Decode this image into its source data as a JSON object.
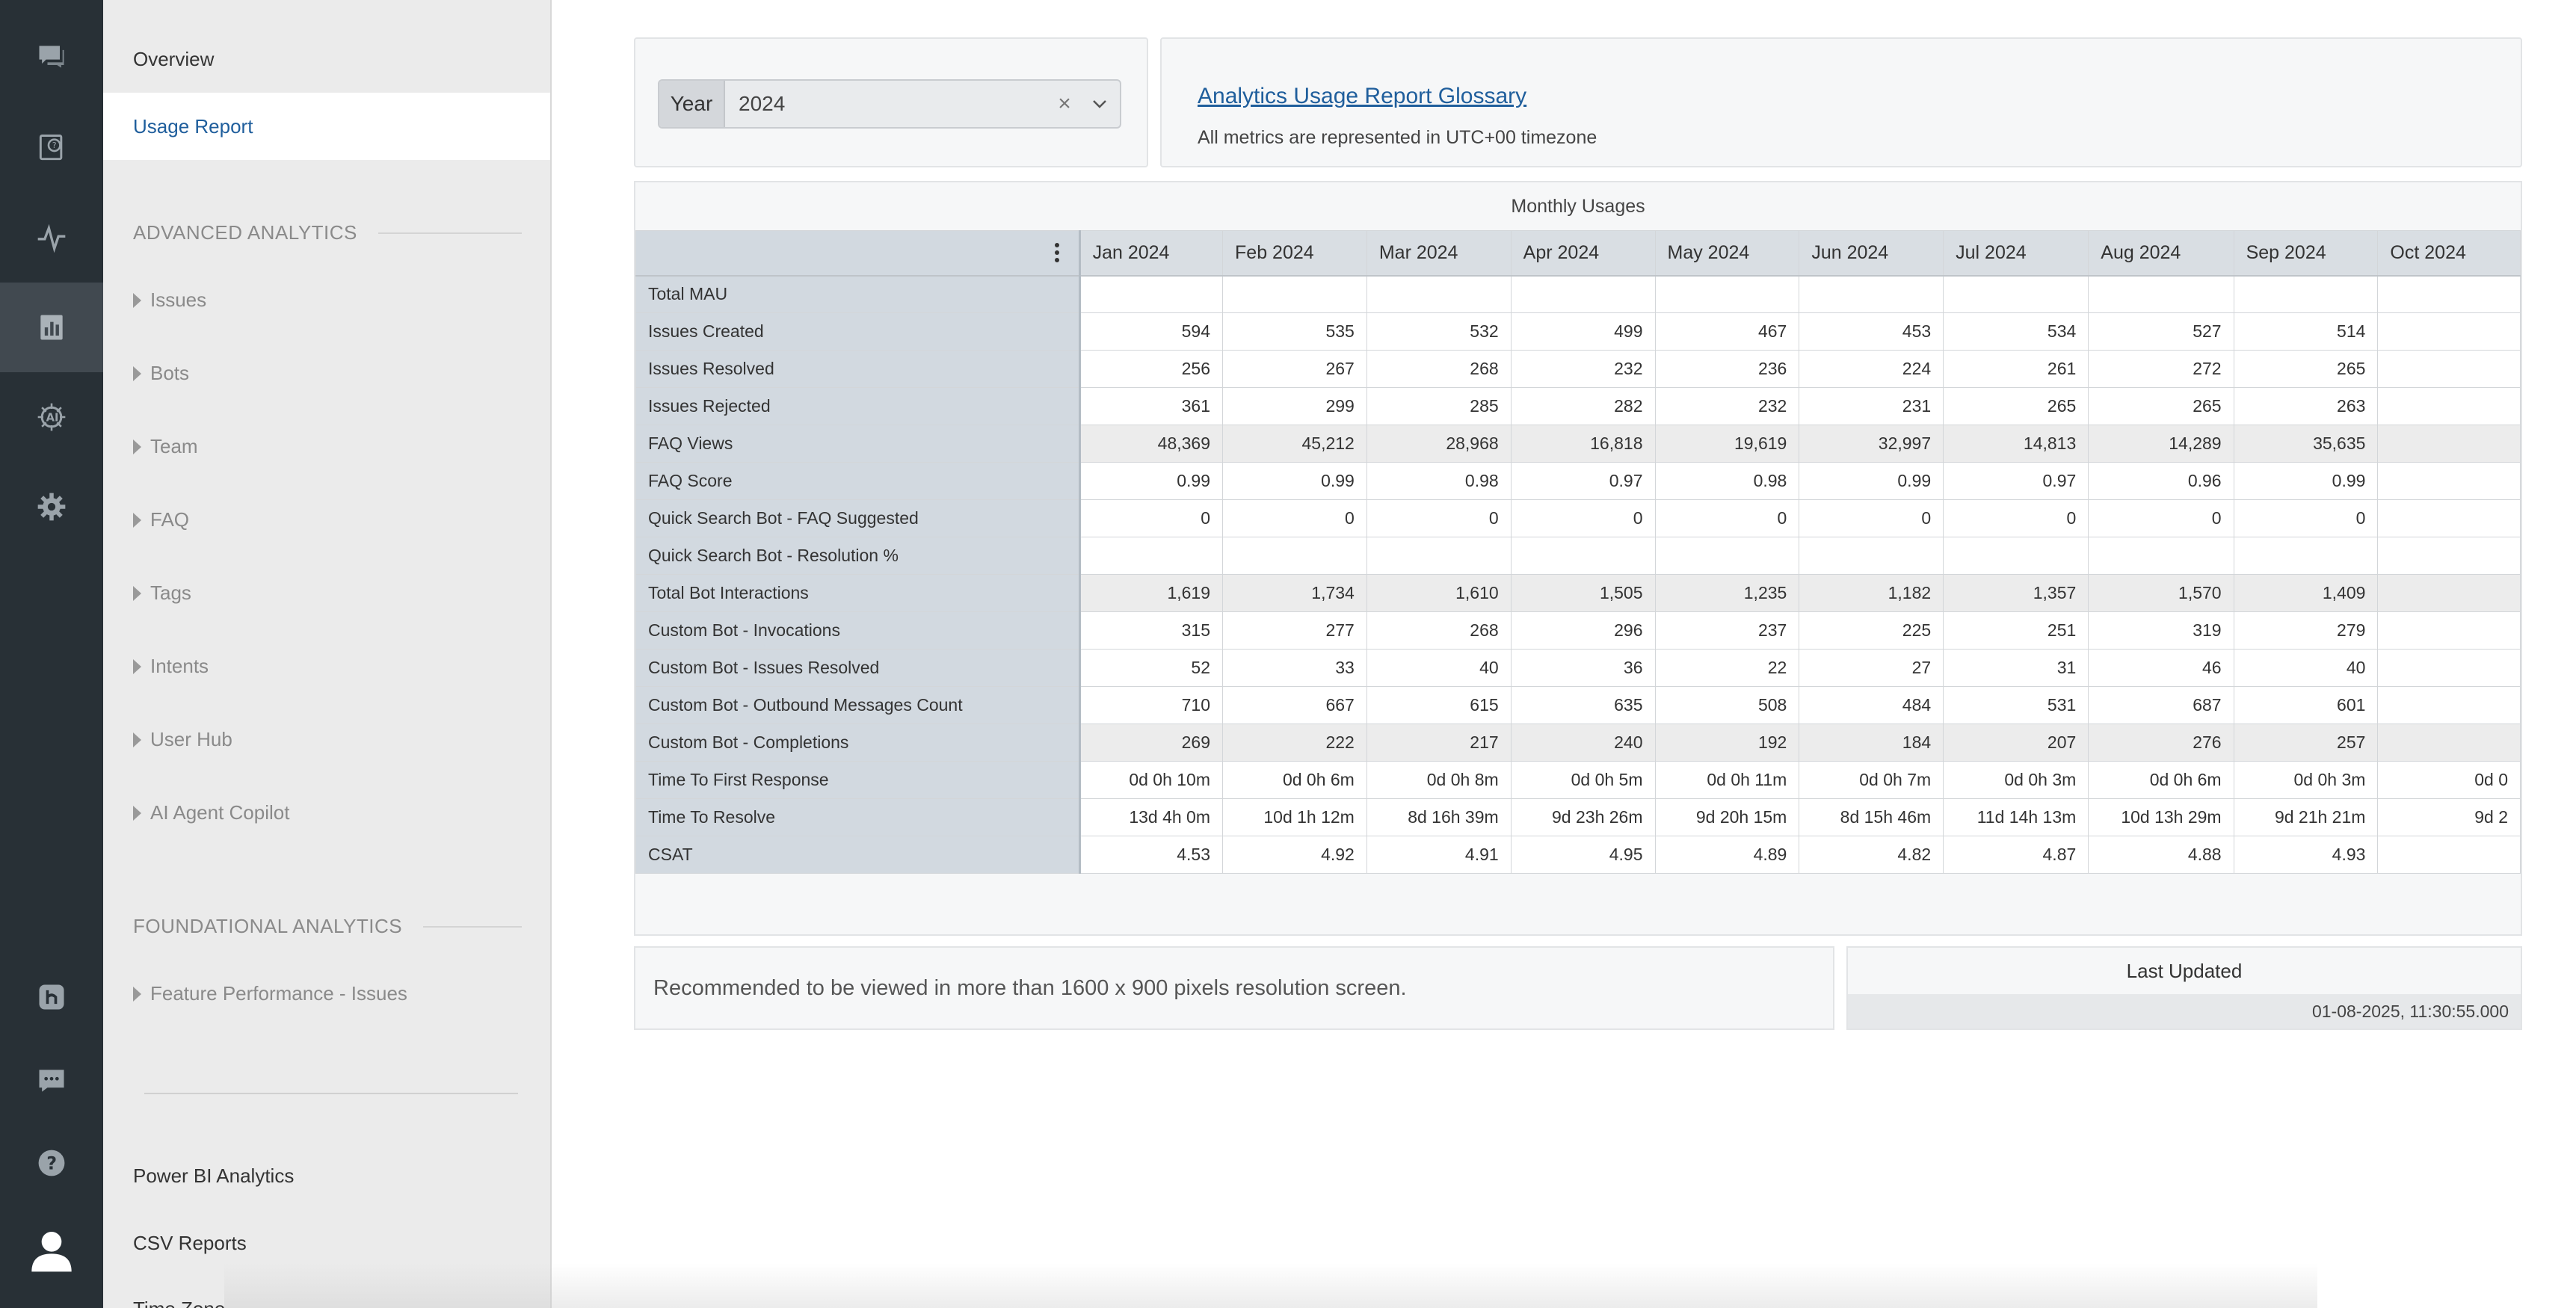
{
  "rail": {
    "icons": [
      "chat-bubble-icon",
      "faq-help-icon",
      "activity-pulse-icon",
      "analytics-bar-chart-icon",
      "ai-brain-icon",
      "settings-gear-icon",
      "helpshift-h-icon",
      "messages-icon",
      "help-question-icon",
      "user-avatar-icon"
    ],
    "active": "analytics-bar-chart-icon"
  },
  "subnav": {
    "overview": "Overview",
    "usage_report": "Usage Report",
    "advanced_heading": "ADVANCED ANALYTICS",
    "advanced_items": [
      "Issues",
      "Bots",
      "Team",
      "FAQ",
      "Tags",
      "Intents",
      "User Hub",
      "AI Agent Copilot"
    ],
    "foundational_heading": "FOUNDATIONAL ANALYTICS",
    "foundational_items": [
      "Feature Performance - Issues"
    ],
    "power_bi": "Power BI Analytics",
    "csv_reports": "CSV Reports",
    "cut_off_item": "Time Zone"
  },
  "filter": {
    "label": "Year",
    "value": "2024"
  },
  "glossary": {
    "link": "Analytics Usage Report Glossary",
    "timezone_note": "All metrics are represented in UTC+00 timezone"
  },
  "table": {
    "title": "Monthly Usages",
    "months": [
      "Jan 2024",
      "Feb 2024",
      "Mar 2024",
      "Apr 2024",
      "May 2024",
      "Jun 2024",
      "Jul 2024",
      "Aug 2024",
      "Sep 2024",
      "Oct 2024"
    ],
    "rows": [
      {
        "label": "Total MAU",
        "values": [
          "",
          "",
          "",
          "",
          "",
          "",
          "",
          "",
          "",
          ""
        ]
      },
      {
        "label": "Issues Created",
        "values": [
          "594",
          "535",
          "532",
          "499",
          "467",
          "453",
          "534",
          "527",
          "514",
          ""
        ]
      },
      {
        "label": "Issues Resolved",
        "values": [
          "256",
          "267",
          "268",
          "232",
          "236",
          "224",
          "261",
          "272",
          "265",
          ""
        ]
      },
      {
        "label": "Issues Rejected",
        "values": [
          "361",
          "299",
          "285",
          "282",
          "232",
          "231",
          "265",
          "265",
          "263",
          ""
        ]
      },
      {
        "label": "FAQ Views",
        "values": [
          "48,369",
          "45,212",
          "28,968",
          "16,818",
          "19,619",
          "32,997",
          "14,813",
          "14,289",
          "35,635",
          ""
        ]
      },
      {
        "label": "FAQ Score",
        "values": [
          "0.99",
          "0.99",
          "0.98",
          "0.97",
          "0.98",
          "0.99",
          "0.97",
          "0.96",
          "0.99",
          ""
        ]
      },
      {
        "label": "Quick Search Bot - FAQ Suggested",
        "values": [
          "0",
          "0",
          "0",
          "0",
          "0",
          "0",
          "0",
          "0",
          "0",
          ""
        ]
      },
      {
        "label": "Quick Search Bot - Resolution %",
        "values": [
          "",
          "",
          "",
          "",
          "",
          "",
          "",
          "",
          "",
          ""
        ]
      },
      {
        "label": "Total Bot Interactions",
        "values": [
          "1,619",
          "1,734",
          "1,610",
          "1,505",
          "1,235",
          "1,182",
          "1,357",
          "1,570",
          "1,409",
          ""
        ]
      },
      {
        "label": "Custom Bot - Invocations",
        "values": [
          "315",
          "277",
          "268",
          "296",
          "237",
          "225",
          "251",
          "319",
          "279",
          ""
        ]
      },
      {
        "label": "Custom Bot - Issues Resolved",
        "values": [
          "52",
          "33",
          "40",
          "36",
          "22",
          "27",
          "31",
          "46",
          "40",
          ""
        ]
      },
      {
        "label": "Custom Bot - Outbound Messages Count",
        "values": [
          "710",
          "667",
          "615",
          "635",
          "508",
          "484",
          "531",
          "687",
          "601",
          ""
        ]
      },
      {
        "label": "Custom Bot - Completions",
        "values": [
          "269",
          "222",
          "217",
          "240",
          "192",
          "184",
          "207",
          "276",
          "257",
          ""
        ]
      },
      {
        "label": "Time To First Response",
        "values": [
          "0d 0h 10m",
          "0d 0h 6m",
          "0d 0h 8m",
          "0d 0h 5m",
          "0d 0h 11m",
          "0d 0h 7m",
          "0d 0h 3m",
          "0d 0h 6m",
          "0d 0h 3m",
          "0d 0"
        ]
      },
      {
        "label": "Time To Resolve",
        "values": [
          "13d 4h 0m",
          "10d 1h 12m",
          "8d 16h 39m",
          "9d 23h 26m",
          "9d 20h 15m",
          "8d 15h 46m",
          "11d 14h 13m",
          "10d 13h 29m",
          "9d 21h 21m",
          "9d 2"
        ]
      },
      {
        "label": "CSAT",
        "values": [
          "4.53",
          "4.92",
          "4.91",
          "4.95",
          "4.89",
          "4.82",
          "4.87",
          "4.88",
          "4.93",
          ""
        ]
      }
    ]
  },
  "recommendation": "Recommended to be viewed in more than 1600 x 900 pixels resolution screen.",
  "last_updated": {
    "title": "Last Updated",
    "value": "01-08-2025, 11:30:55.000"
  }
}
